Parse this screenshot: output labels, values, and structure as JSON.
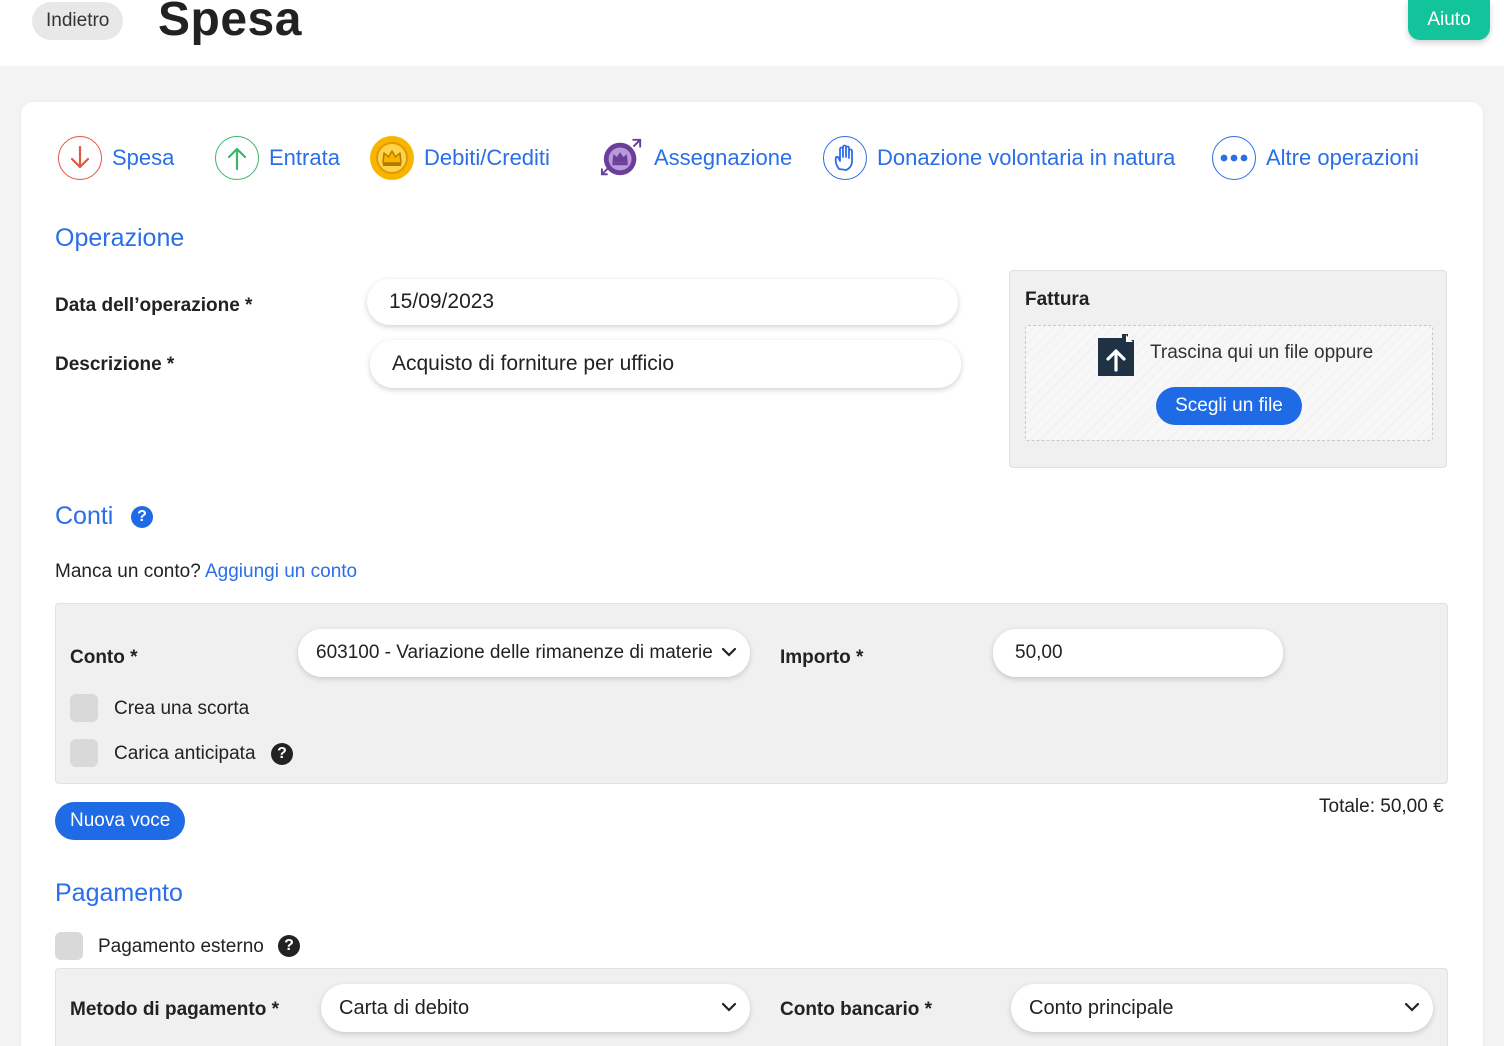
{
  "header": {
    "back_label": "Indietro",
    "title": "Spesa",
    "help_label": "Aiuto"
  },
  "operation_types": [
    {
      "label": "Spesa",
      "icon": "arrow-down-icon",
      "color": "#e2553e"
    },
    {
      "label": "Entrata",
      "icon": "arrow-up-icon",
      "color": "#3bb56a"
    },
    {
      "label": "Debiti/Crediti",
      "icon": "crown-icon",
      "color": "#f0b400"
    },
    {
      "label": "Assegnazione",
      "icon": "crown-assign-icon",
      "color": "#6a3e9a"
    },
    {
      "label": "Donazione volontaria in natura",
      "icon": "hand-icon",
      "color": "#2a6ee8"
    },
    {
      "label": "Altre operazioni",
      "icon": "more-icon",
      "color": "#2a6ee8"
    }
  ],
  "operazione": {
    "title": "Operazione",
    "date_label": "Data dell’operazione *",
    "date_value": "15/09/2023",
    "description_label": "Descrizione *",
    "description_value": "Acquisto di forniture per ufficio"
  },
  "fattura": {
    "title": "Fattura",
    "drop_text": "Trascina qui un file oppure",
    "choose_label": "Scegli un file"
  },
  "conti": {
    "title": "Conti",
    "missing_text": "Manca un conto?",
    "add_link": "Aggiungi un conto",
    "account_label": "Conto *",
    "account_value": "603100 - Variazione delle rimanenze di materie",
    "amount_label": "Importo *",
    "amount_value": "50,00",
    "stock_label": "Crea una scorta",
    "advance_label": "Carica anticipata",
    "new_item_label": "Nuova voce",
    "total_text": "Totale: 50,00 €"
  },
  "pagamento": {
    "title": "Pagamento",
    "external_label": "Pagamento esterno",
    "method_label": "Metodo di pagamento *",
    "method_value": "Carta di debito",
    "bank_label": "Conto bancario *",
    "bank_value": "Conto principale"
  },
  "colors": {
    "accent": "#2a6ee8",
    "button": "#1f6be6",
    "help": "#13c39c"
  }
}
